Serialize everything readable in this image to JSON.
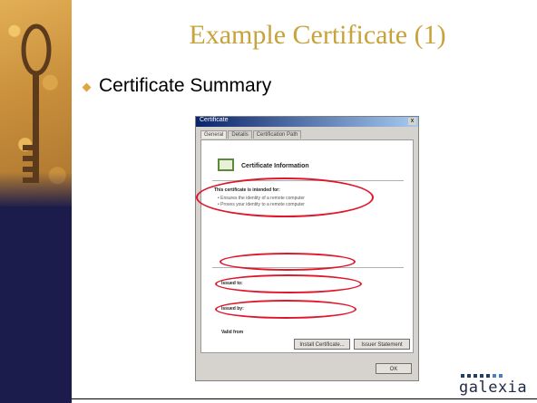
{
  "slide": {
    "title": "Example Certificate (1)",
    "bullet": "Certificate Summary"
  },
  "dialog": {
    "window_title": "Certificate",
    "close_glyph": "x",
    "tabs": [
      "General",
      "Details",
      "Certification Path"
    ],
    "header": "Certificate Information",
    "intended_heading": "This certificate is intended for:",
    "intended_line1": "• Ensures the identity of a remote computer",
    "intended_line2": "• Proves your identity to a remote computer",
    "issued_to_label": "Issued to:",
    "issued_to_value": "",
    "issued_by_label": "Issued by:",
    "issued_by_value": "",
    "valid_label": "Valid from",
    "valid_value": "",
    "issuer_button": "Install Certificate...",
    "statement_button": "Issuer Statement",
    "ok_button": "OK"
  },
  "logo": {
    "text": "galexia"
  },
  "colors": {
    "title": "#c8a23a",
    "bullet": "#e0a640",
    "highlight_ring": "#e0162b",
    "sidebar": "#1c1c4c"
  },
  "icons": [
    "key-icon",
    "certificate-icon",
    "diamond-bullet-icon"
  ]
}
